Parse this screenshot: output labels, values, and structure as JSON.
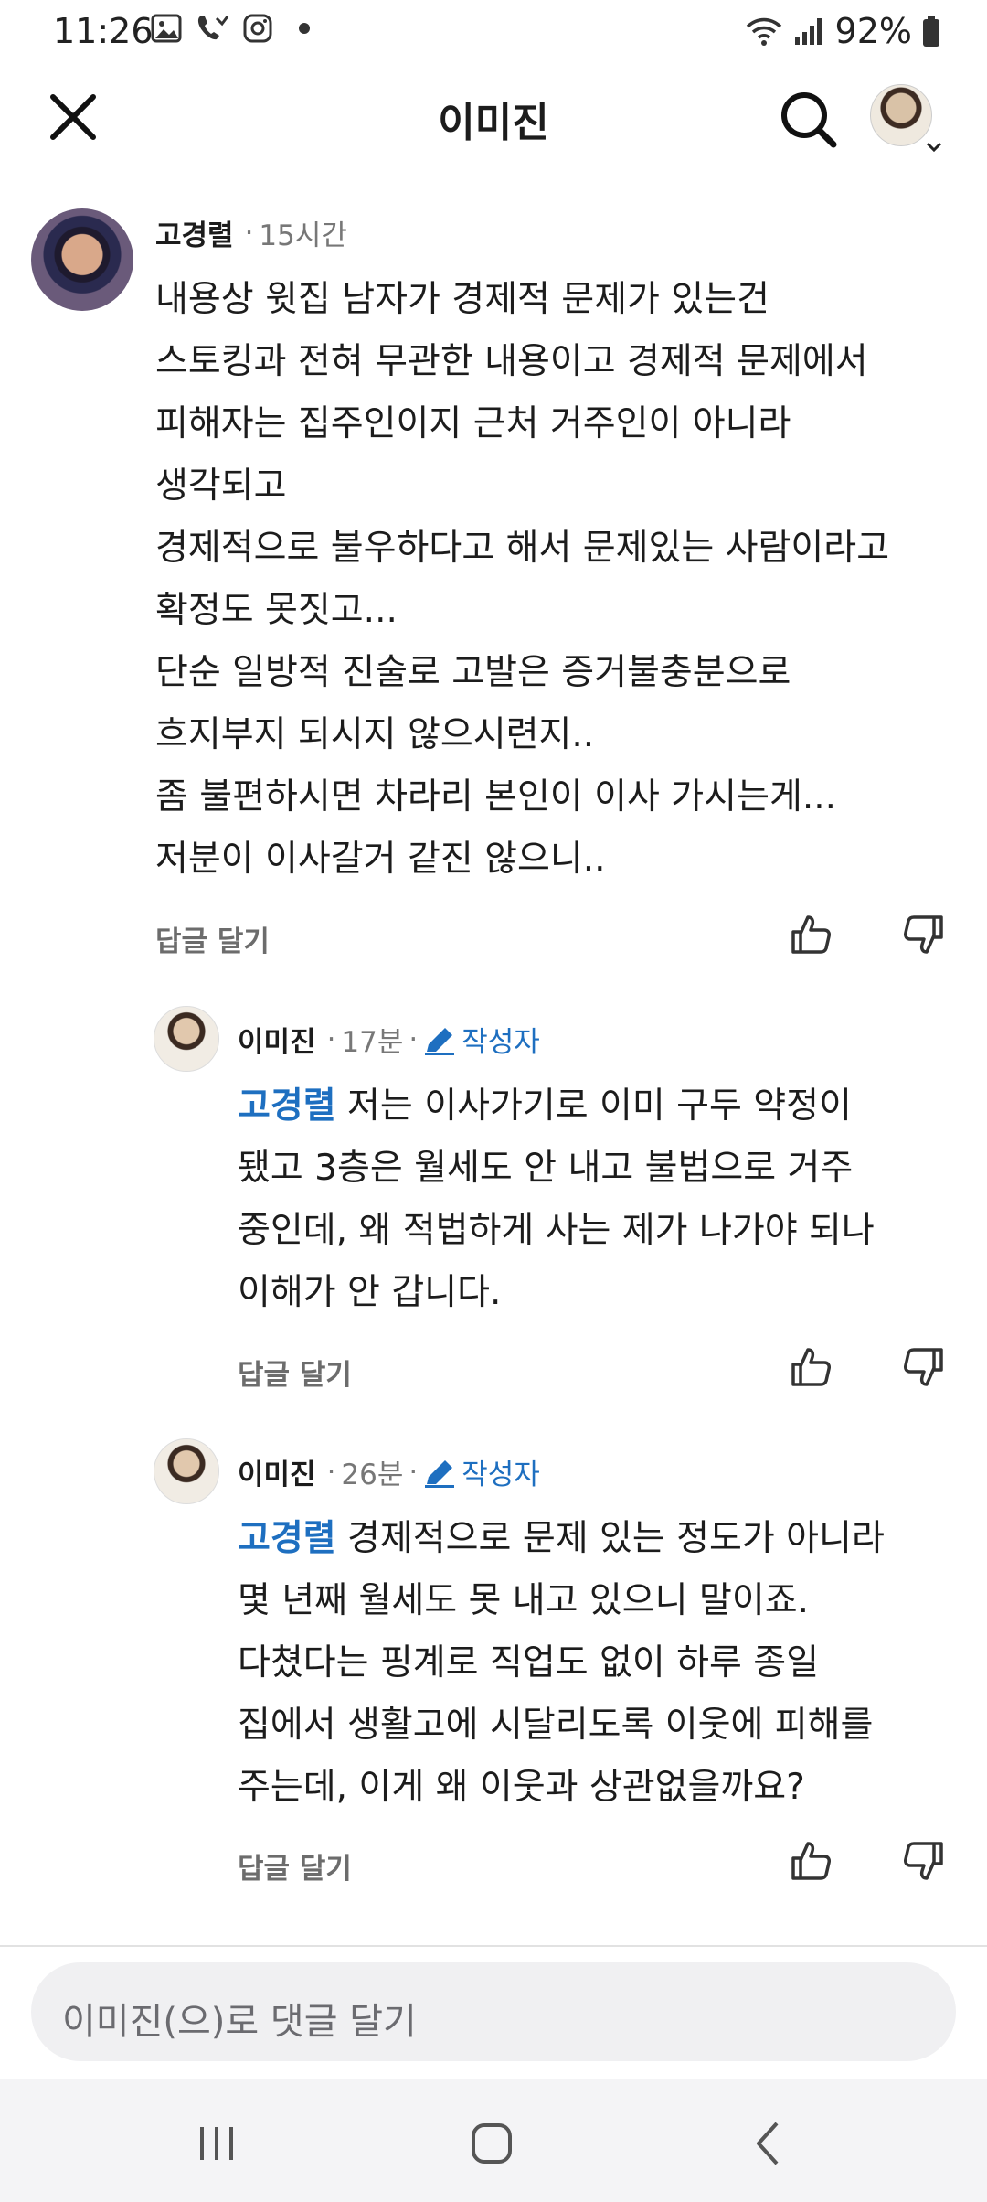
{
  "status_bar": {
    "time": "11:26",
    "battery": "92%",
    "left_icons": [
      "gallery-icon",
      "missed-call-icon",
      "instagram-icon",
      "dot-icon"
    ],
    "right_icons": [
      "wifi-icon",
      "signal-icon",
      "battery-icon"
    ]
  },
  "header": {
    "title": "이미진",
    "close_icon": "close-icon",
    "search_icon": "search-icon"
  },
  "comments": [
    {
      "author": "고경렬",
      "time": "15시간",
      "lines": [
        "내용상 윗집 남자가 경제적 문제가 있는건",
        "스토킹과 전혀 무관한 내용이고 경제적 문제에서",
        "피해자는 집주인이지 근처 거주인이 아니라",
        "생각되고",
        "경제적으로 불우하다고 해서 문제있는 사람이라고",
        "확정도 못짓고...",
        "단순 일방적 진술로 고발은 증거불충분으로",
        "흐지부지 되시지 않으시련지..",
        "좀 불편하시면 차라리 본인이 이사 가시는게...",
        "저분이 이사갈거 같진 않으니.."
      ],
      "reply_label": "답글 달기"
    },
    {
      "author": "이미진",
      "time": "17분",
      "op_label": "작성자",
      "mention": "고경렬",
      "first_line_rest": " 저는 이사가기로 이미 구두 약정이",
      "lines": [
        "됐고 3층은 월세도 안 내고 불법으로 거주",
        "중인데, 왜 적법하게 사는 제가 나가야 되나",
        "이해가 안 갑니다."
      ],
      "reply_label": "답글 달기"
    },
    {
      "author": "이미진",
      "time": "26분",
      "op_label": "작성자",
      "mention": "고경렬",
      "first_line_rest": " 경제적으로 문제 있는 정도가 아니라",
      "lines": [
        "몇 년째 월세도 못 내고 있으니 말이죠.",
        "다쳤다는 핑계로 직업도 없이 하루 종일",
        "집에서 생활고에 시달리도록 이웃에 피해를",
        "주는데, 이게 왜 이웃과 상관없을까요?"
      ],
      "reply_label": "답글 달기"
    }
  ],
  "composer": {
    "placeholder": "이미진(으)로 댓글 달기"
  },
  "nav_bar": {
    "buttons": [
      "recent-apps-icon",
      "home-icon",
      "back-icon"
    ]
  },
  "colors": {
    "accent": "#1e6fc0",
    "text": "#1c1c1c",
    "muted": "#777777",
    "composer_bg": "#f0f0f2"
  }
}
